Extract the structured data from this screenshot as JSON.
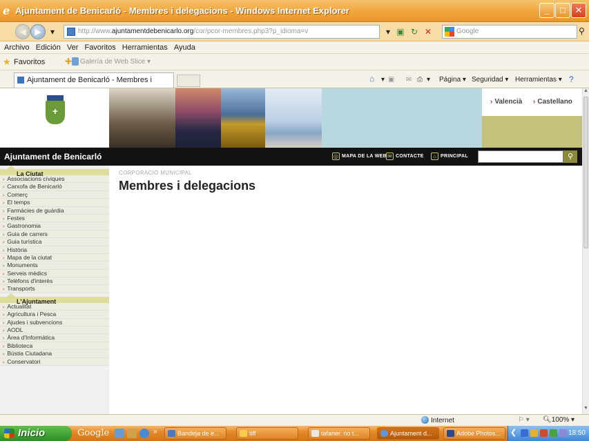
{
  "window": {
    "title": "Ajuntament de Benicarló - Membres i delegacions - Windows Internet Explorer"
  },
  "address": {
    "prefix": "http://www.",
    "domain": "ajuntamentdebenicarlo.org",
    "path": "/cor/pcor-membres.php3?p_idioma=v",
    "search_placeholder": "Google"
  },
  "menu": [
    "Archivo",
    "Edición",
    "Ver",
    "Favoritos",
    "Herramientas",
    "Ayuda"
  ],
  "favorites": {
    "label": "Favoritos",
    "slice": "Galería de Web Slice ▾"
  },
  "tab": {
    "title": "Ajuntament de Benicarló - Membres i delegacions"
  },
  "commands": {
    "pagina": "Página ▾",
    "seguridad": "Seguridad ▾",
    "herramientas": "Herramientas ▾"
  },
  "site": {
    "name": "Ajuntament de Benicarló",
    "lang_valencia": "Valencià",
    "lang_castellano": "Castellano",
    "mapa": "MAPA DE LA WEB",
    "contacte": "CONTACTE",
    "principal": "PRINCIPAL"
  },
  "sidebar": {
    "ciutat_head": "La Ciutat",
    "ciutat_items": [
      "Associacions cíviques",
      "Carxofa de Benicarló",
      "Comerç",
      "El temps",
      "Farmàcies de guàrdia",
      "Festes",
      "Gastronomia",
      "Guia de carrers",
      "Guia turística",
      "Història",
      "Mapa de la ciutat",
      "Monuments",
      "Serveis mèdics",
      "Telèfons d'interès",
      "Transports"
    ],
    "ajuntament_head": "L'Ajuntament",
    "ajuntament_items": [
      "Actualitat",
      "Agricultura i Pesca",
      "Ajudes i subvencions",
      "AODL",
      "Àrea d'Informàtica",
      "Biblioteca",
      "Bústia Ciutadana",
      "Conservatori"
    ]
  },
  "main": {
    "breadcrumb": "CORPORACIÓ MUNICIPAL",
    "title": "Membres i delegacions"
  },
  "status": {
    "zone": "Internet",
    "zoom": "100%"
  },
  "taskbar": {
    "start": "Inicio",
    "google": "Google",
    "tasks": [
      "Bandeja de e...",
      "tiff",
      "tafaner. no t...",
      "Ajuntament d...",
      "Adobe Photos..."
    ],
    "clock": "18:50"
  }
}
